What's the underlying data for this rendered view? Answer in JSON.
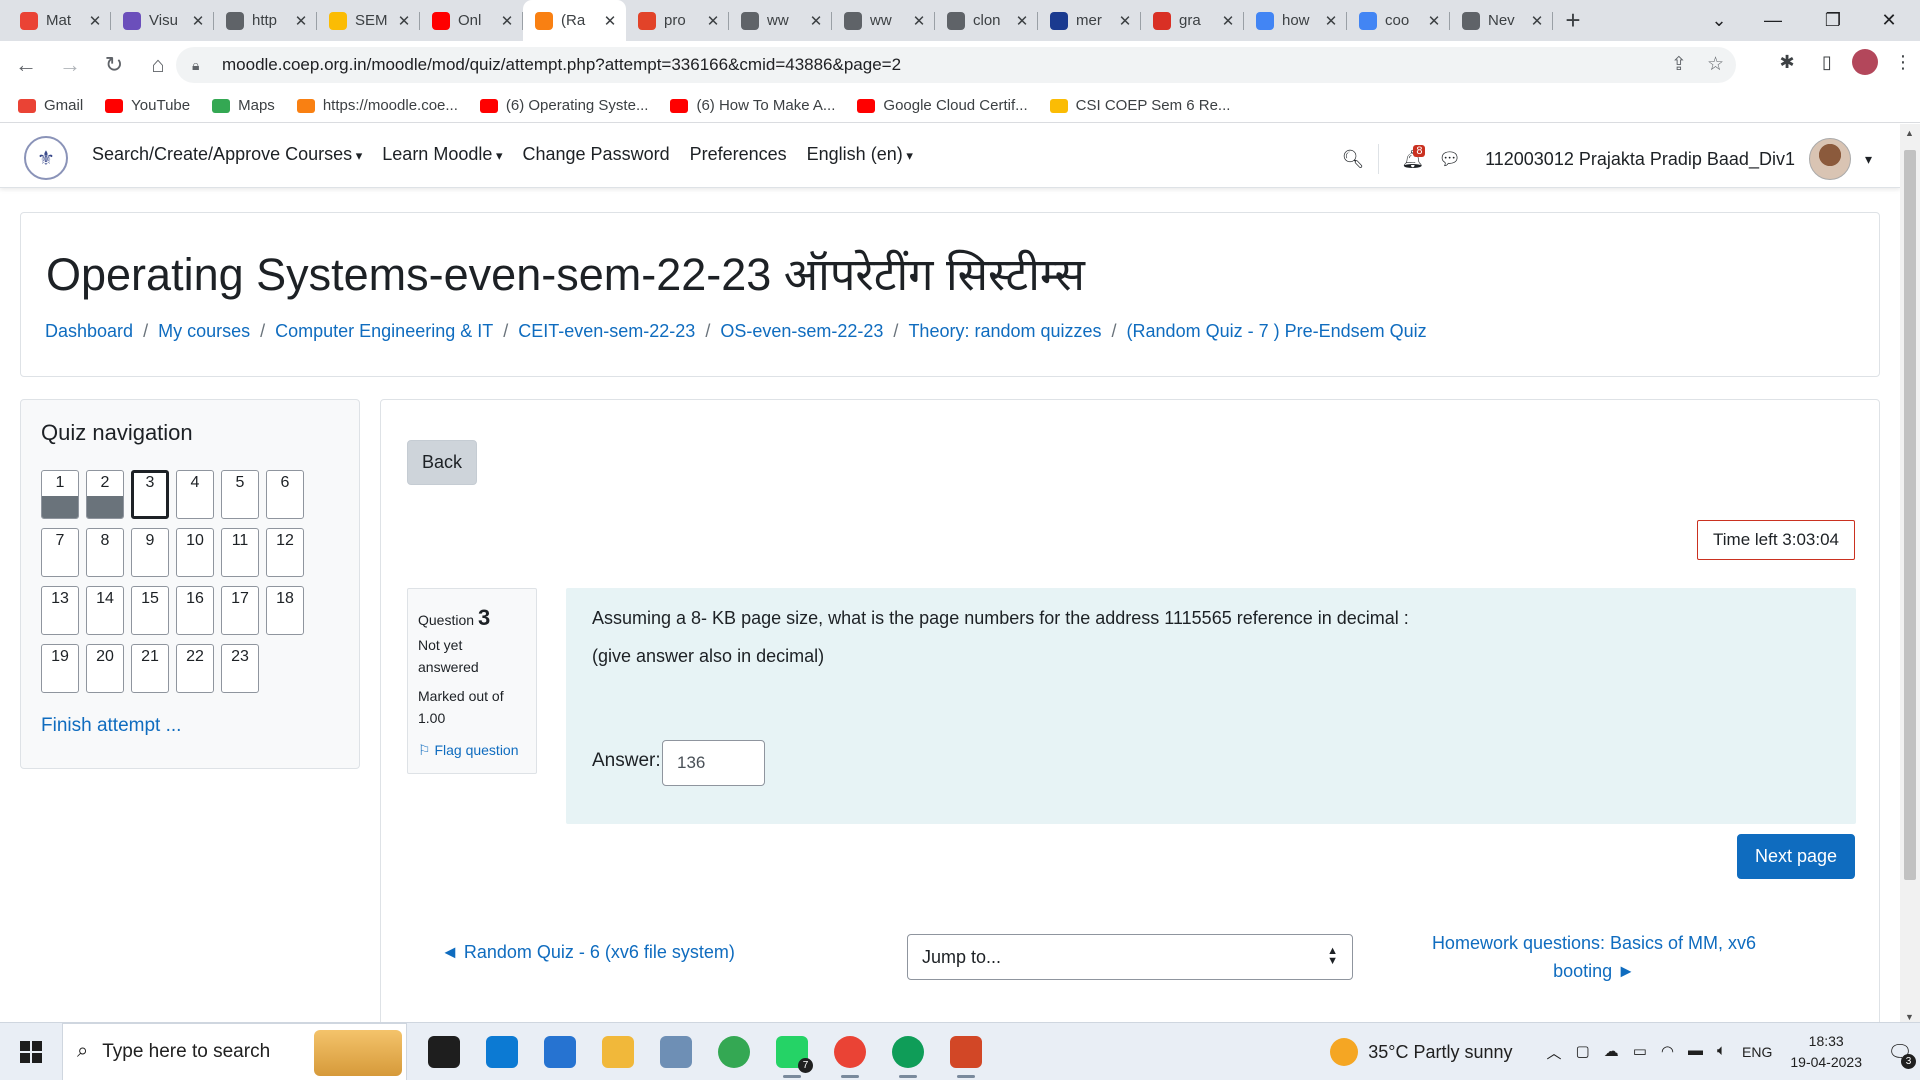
{
  "browser": {
    "tabs": [
      {
        "title": "Mat",
        "icon": "gmail-icon",
        "color": "#ea4335",
        "active": false
      },
      {
        "title": "Visu",
        "icon": "visualization-icon",
        "color": "#6b4fbb",
        "active": false
      },
      {
        "title": "http",
        "icon": "globe-icon",
        "color": "#5f6368",
        "active": false
      },
      {
        "title": "SEM",
        "icon": "google-drive-icon",
        "color": "#fbbc04",
        "active": false
      },
      {
        "title": "Onl",
        "icon": "youtube-icon",
        "color": "#ff0000",
        "active": false
      },
      {
        "title": "(Ra",
        "icon": "moodle-icon",
        "color": "#f98012",
        "active": true
      },
      {
        "title": "pro",
        "icon": "gitlab-icon",
        "color": "#e24329",
        "active": false
      },
      {
        "title": "ww",
        "icon": "link-icon",
        "color": "#5f6368",
        "active": false
      },
      {
        "title": "ww",
        "icon": "link-icon",
        "color": "#5f6368",
        "active": false
      },
      {
        "title": "clon",
        "icon": "globe-icon",
        "color": "#5f6368",
        "active": false
      },
      {
        "title": "mer",
        "icon": "university-icon",
        "color": "#1a3a8f",
        "active": false
      },
      {
        "title": "gra",
        "icon": "code-braces-icon",
        "color": "#d93025",
        "active": false
      },
      {
        "title": "how",
        "icon": "google-icon",
        "color": "#4285f4",
        "active": false
      },
      {
        "title": "coo",
        "icon": "google-icon",
        "color": "#4285f4",
        "active": false
      },
      {
        "title": "Nev",
        "icon": "chrome-icon",
        "color": "#5f6368",
        "active": false
      }
    ],
    "new_tab": "+",
    "url": "moodle.coep.org.in/moodle/mod/quiz/attempt.php?attempt=336166&cmid=43886&page=2",
    "bookmarks": [
      {
        "label": "Gmail",
        "icon": "gmail-icon",
        "color": "#ea4335"
      },
      {
        "label": "YouTube",
        "icon": "youtube-icon",
        "color": "#ff0000"
      },
      {
        "label": "Maps",
        "icon": "maps-icon",
        "color": "#34a853"
      },
      {
        "label": "https://moodle.coe...",
        "icon": "moodle-icon",
        "color": "#f98012"
      },
      {
        "label": "(6) Operating Syste...",
        "icon": "youtube-icon",
        "color": "#ff0000"
      },
      {
        "label": "(6) How To Make A...",
        "icon": "youtube-icon",
        "color": "#ff0000"
      },
      {
        "label": "Google Cloud Certif...",
        "icon": "youtube-icon",
        "color": "#ff0000"
      },
      {
        "label": "CSI COEP Sem 6 Re...",
        "icon": "google-drive-icon",
        "color": "#fbbc04"
      }
    ]
  },
  "moodle": {
    "menu": [
      {
        "label": "Search/Create/Approve Courses",
        "dropdown": true
      },
      {
        "label": "Learn Moodle",
        "dropdown": true
      },
      {
        "label": "Change Password",
        "dropdown": false
      },
      {
        "label": "Preferences",
        "dropdown": false
      },
      {
        "label": "English (en)",
        "dropdown": true
      }
    ],
    "notification_count": "8",
    "user_name": "112003012 Prajakta Pradip Baad_Div1",
    "course_title": "Operating Systems-even-sem-22-23 ऑपरेटींग सिस्टीम्स",
    "breadcrumb": [
      "Dashboard",
      "My courses",
      "Computer Engineering & IT",
      "CEIT-even-sem-22-23",
      "OS-even-sem-22-23",
      "Theory: random quizzes",
      "(Random Quiz - 7 ) Pre-Endsem Quiz"
    ],
    "quiz_nav": {
      "title": "Quiz navigation",
      "questions": [
        {
          "n": "1",
          "state": "answered"
        },
        {
          "n": "2",
          "state": "answered"
        },
        {
          "n": "3",
          "state": "current"
        },
        {
          "n": "4",
          "state": "empty"
        },
        {
          "n": "5",
          "state": "empty"
        },
        {
          "n": "6",
          "state": "empty"
        },
        {
          "n": "7",
          "state": "empty"
        },
        {
          "n": "8",
          "state": "empty"
        },
        {
          "n": "9",
          "state": "empty"
        },
        {
          "n": "10",
          "state": "empty"
        },
        {
          "n": "11",
          "state": "empty"
        },
        {
          "n": "12",
          "state": "empty"
        },
        {
          "n": "13",
          "state": "empty"
        },
        {
          "n": "14",
          "state": "empty"
        },
        {
          "n": "15",
          "state": "empty"
        },
        {
          "n": "16",
          "state": "empty"
        },
        {
          "n": "17",
          "state": "empty"
        },
        {
          "n": "18",
          "state": "empty"
        },
        {
          "n": "19",
          "state": "empty"
        },
        {
          "n": "20",
          "state": "empty"
        },
        {
          "n": "21",
          "state": "empty"
        },
        {
          "n": "22",
          "state": "empty"
        },
        {
          "n": "23",
          "state": "empty"
        }
      ],
      "finish": "Finish attempt ..."
    },
    "back_label": "Back",
    "timer": "Time left 3:03:04",
    "question": {
      "label": "Question",
      "number": "3",
      "status": "Not yet answered",
      "marks": "Marked out of 1.00",
      "flag": "Flag question",
      "text1": "Assuming a 8- KB page size, what is the page numbers for the address 1115565 reference in decimal :",
      "text2": "(give answer also in decimal)",
      "answer_label": "Answer:",
      "answer_value": "136"
    },
    "next_page": "Next page",
    "prev_activity": "◄ Random Quiz - 6 (xv6 file system)",
    "jump_placeholder": "Jump to...",
    "next_activity": "Homework questions: Basics of MM, xv6 booting ►"
  },
  "taskbar": {
    "search_placeholder": "Type here to search",
    "apps": [
      {
        "name": "terminal-icon",
        "color": "#1e1e1e",
        "open": false
      },
      {
        "name": "edge-icon",
        "color": "#0c7ad3",
        "open": false
      },
      {
        "name": "mail-icon",
        "color": "#2673d1",
        "open": false
      },
      {
        "name": "file-explorer-icon",
        "color": "#f1b83a",
        "open": false
      },
      {
        "name": "notes-icon",
        "color": "#6e8fb5",
        "open": false
      },
      {
        "name": "chrome-icon",
        "color": "#34a853",
        "open": false
      },
      {
        "name": "whatsapp-icon",
        "color": "#25d366",
        "open": true
      },
      {
        "name": "chrome-profile-icon",
        "color": "#ea4335",
        "open": true
      },
      {
        "name": "chrome-profile-2-icon",
        "color": "#0f9d58",
        "open": true
      },
      {
        "name": "powerpoint-icon",
        "color": "#d24726",
        "open": true
      }
    ],
    "whatsapp_badge": "7",
    "weather": "35°C  Partly sunny",
    "language": "ENG",
    "time": "18:33",
    "date": "19-04-2023",
    "notification_badge": "3"
  }
}
